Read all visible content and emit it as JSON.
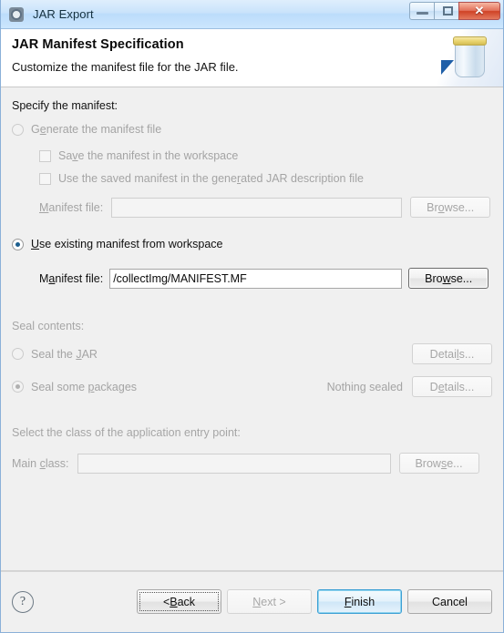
{
  "window": {
    "title": "JAR Export",
    "icon": "gear-icon",
    "controls": {
      "minimize": "minimize-icon",
      "maximize": "maximize-icon",
      "close": "✕"
    }
  },
  "header": {
    "title": "JAR Manifest Specification",
    "subtitle": "Customize the manifest file for the JAR file.",
    "artwork": "jar-illustration"
  },
  "manifest_section": {
    "group_label": "Specify the manifest:",
    "generate_radio": {
      "label_before": "G",
      "label_mnemonic": "e",
      "label_after": "nerate the manifest file",
      "full": "Generate the manifest file",
      "checked": false,
      "enabled": false
    },
    "save_checkbox": {
      "label_before": "Sa",
      "label_mnemonic": "v",
      "label_after": "e the manifest in the workspace",
      "full": "Save the manifest in the workspace",
      "checked": false,
      "enabled": false
    },
    "use_saved_checkbox": {
      "label_before": "Use the saved manifest in the gene",
      "label_mnemonic": "r",
      "label_after": "ated JAR description file",
      "full": "Use the saved manifest in the generated JAR description file",
      "checked": false,
      "enabled": false
    },
    "manifest_file_disabled": {
      "label_before": "",
      "label_mnemonic": "M",
      "label_after": "anifest file:",
      "full": "Manifest file:",
      "value": "",
      "enabled": false,
      "browse_before": "Br",
      "browse_mnemonic": "o",
      "browse_after": "wse...",
      "browse_full": "Browse..."
    },
    "use_existing_radio": {
      "label_before": "",
      "label_mnemonic": "U",
      "label_after": "se existing manifest from workspace",
      "full": "Use existing manifest from workspace",
      "checked": true,
      "enabled": true
    },
    "manifest_file_enabled": {
      "label_before": "M",
      "label_mnemonic": "a",
      "label_after": "nifest file:",
      "full": "Manifest file:",
      "value": "/collectImg/MANIFEST.MF",
      "enabled": true,
      "browse_before": "Bro",
      "browse_mnemonic": "w",
      "browse_after": "se...",
      "browse_full": "Browse..."
    }
  },
  "seal_section": {
    "group_label": "Seal contents:",
    "seal_jar_radio": {
      "label_before": "Seal the ",
      "label_mnemonic": "J",
      "label_after": "AR",
      "full": "Seal the JAR",
      "checked": false,
      "enabled": false
    },
    "seal_jar_details": {
      "before": "Detai",
      "mnemonic": "l",
      "after": "s...",
      "full": "Details..."
    },
    "seal_packages_radio": {
      "label_before": "Seal some ",
      "label_mnemonic": "p",
      "label_after": "ackages",
      "full": "Seal some packages",
      "checked": true,
      "enabled": false
    },
    "seal_status": "Nothing sealed",
    "seal_packages_details": {
      "before": "D",
      "mnemonic": "e",
      "after": "tails...",
      "full": "Details..."
    }
  },
  "entry_point_section": {
    "group_label": "Select the class of the application entry point:",
    "main_class": {
      "label_before": "Main ",
      "label_mnemonic": "c",
      "label_after": "lass:",
      "full": "Main class:",
      "value": "",
      "enabled": false,
      "browse_before": "Brow",
      "browse_mnemonic": "s",
      "browse_after": "e...",
      "browse_full": "Browse..."
    }
  },
  "footer": {
    "help_icon": "?",
    "back": {
      "before": "< ",
      "mnemonic": "B",
      "after": "ack",
      "full": "< Back",
      "enabled": true,
      "focused": true
    },
    "next": {
      "before": "",
      "mnemonic": "N",
      "after": "ext >",
      "full": "Next >",
      "enabled": false,
      "focused": false
    },
    "finish": {
      "before": "",
      "mnemonic": "F",
      "after": "inish",
      "full": "Finish",
      "enabled": true,
      "is_default": true
    },
    "cancel": {
      "before": "Cancel",
      "mnemonic": "",
      "after": "",
      "full": "Cancel",
      "enabled": true
    }
  },
  "colors": {
    "titlebar": "#bcdcfb",
    "dialog_bg": "#f0f0f0",
    "accent_default_button": "#3c9fd4",
    "radio_checked": "#1d5f8f",
    "close_button": "#cf4226",
    "disabled_text": "#a4a4a4"
  }
}
